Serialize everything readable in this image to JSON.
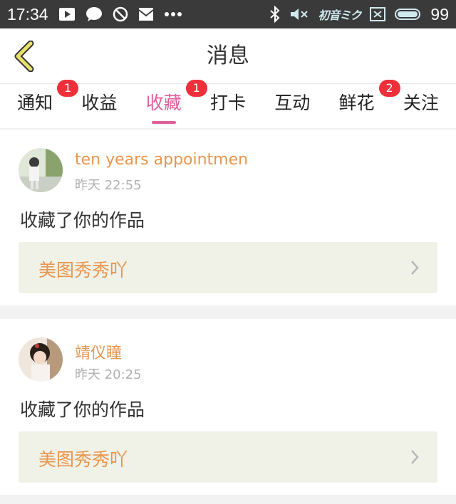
{
  "status_bar": {
    "time": "17:34",
    "battery_level": "99",
    "icons_left": [
      "play-icon",
      "chat-bubble-icon",
      "block-icon",
      "mail-icon",
      "more-dots-icon"
    ],
    "icons_right": [
      "bluetooth-icon",
      "mute-icon",
      "miku-logo",
      "sim-x-icon",
      "battery-icon"
    ],
    "logo_text": "初音ミク"
  },
  "header": {
    "title": "消息"
  },
  "tabs": [
    {
      "label": "通知",
      "badge": "1",
      "active": false
    },
    {
      "label": "收益",
      "badge": "",
      "active": false
    },
    {
      "label": "收藏",
      "badge": "1",
      "active": true
    },
    {
      "label": "打卡",
      "badge": "",
      "active": false
    },
    {
      "label": "互动",
      "badge": "",
      "active": false
    },
    {
      "label": "鲜花",
      "badge": "2",
      "active": false
    },
    {
      "label": "关注",
      "badge": "",
      "active": false
    }
  ],
  "messages": [
    {
      "username": "ten years appointmen",
      "time": "昨天 22:55",
      "action": "收藏了你的作品",
      "work_title": "美图秀秀吖"
    },
    {
      "username": "靖仪瞳",
      "time": "昨天 20:25",
      "action": "收藏了你的作品",
      "work_title": "美图秀秀吖"
    }
  ],
  "colors": {
    "accent": "#e0609a",
    "username": "#e8954e",
    "badge": "#ef2f3a",
    "back_arrow": "#e8e06a"
  }
}
